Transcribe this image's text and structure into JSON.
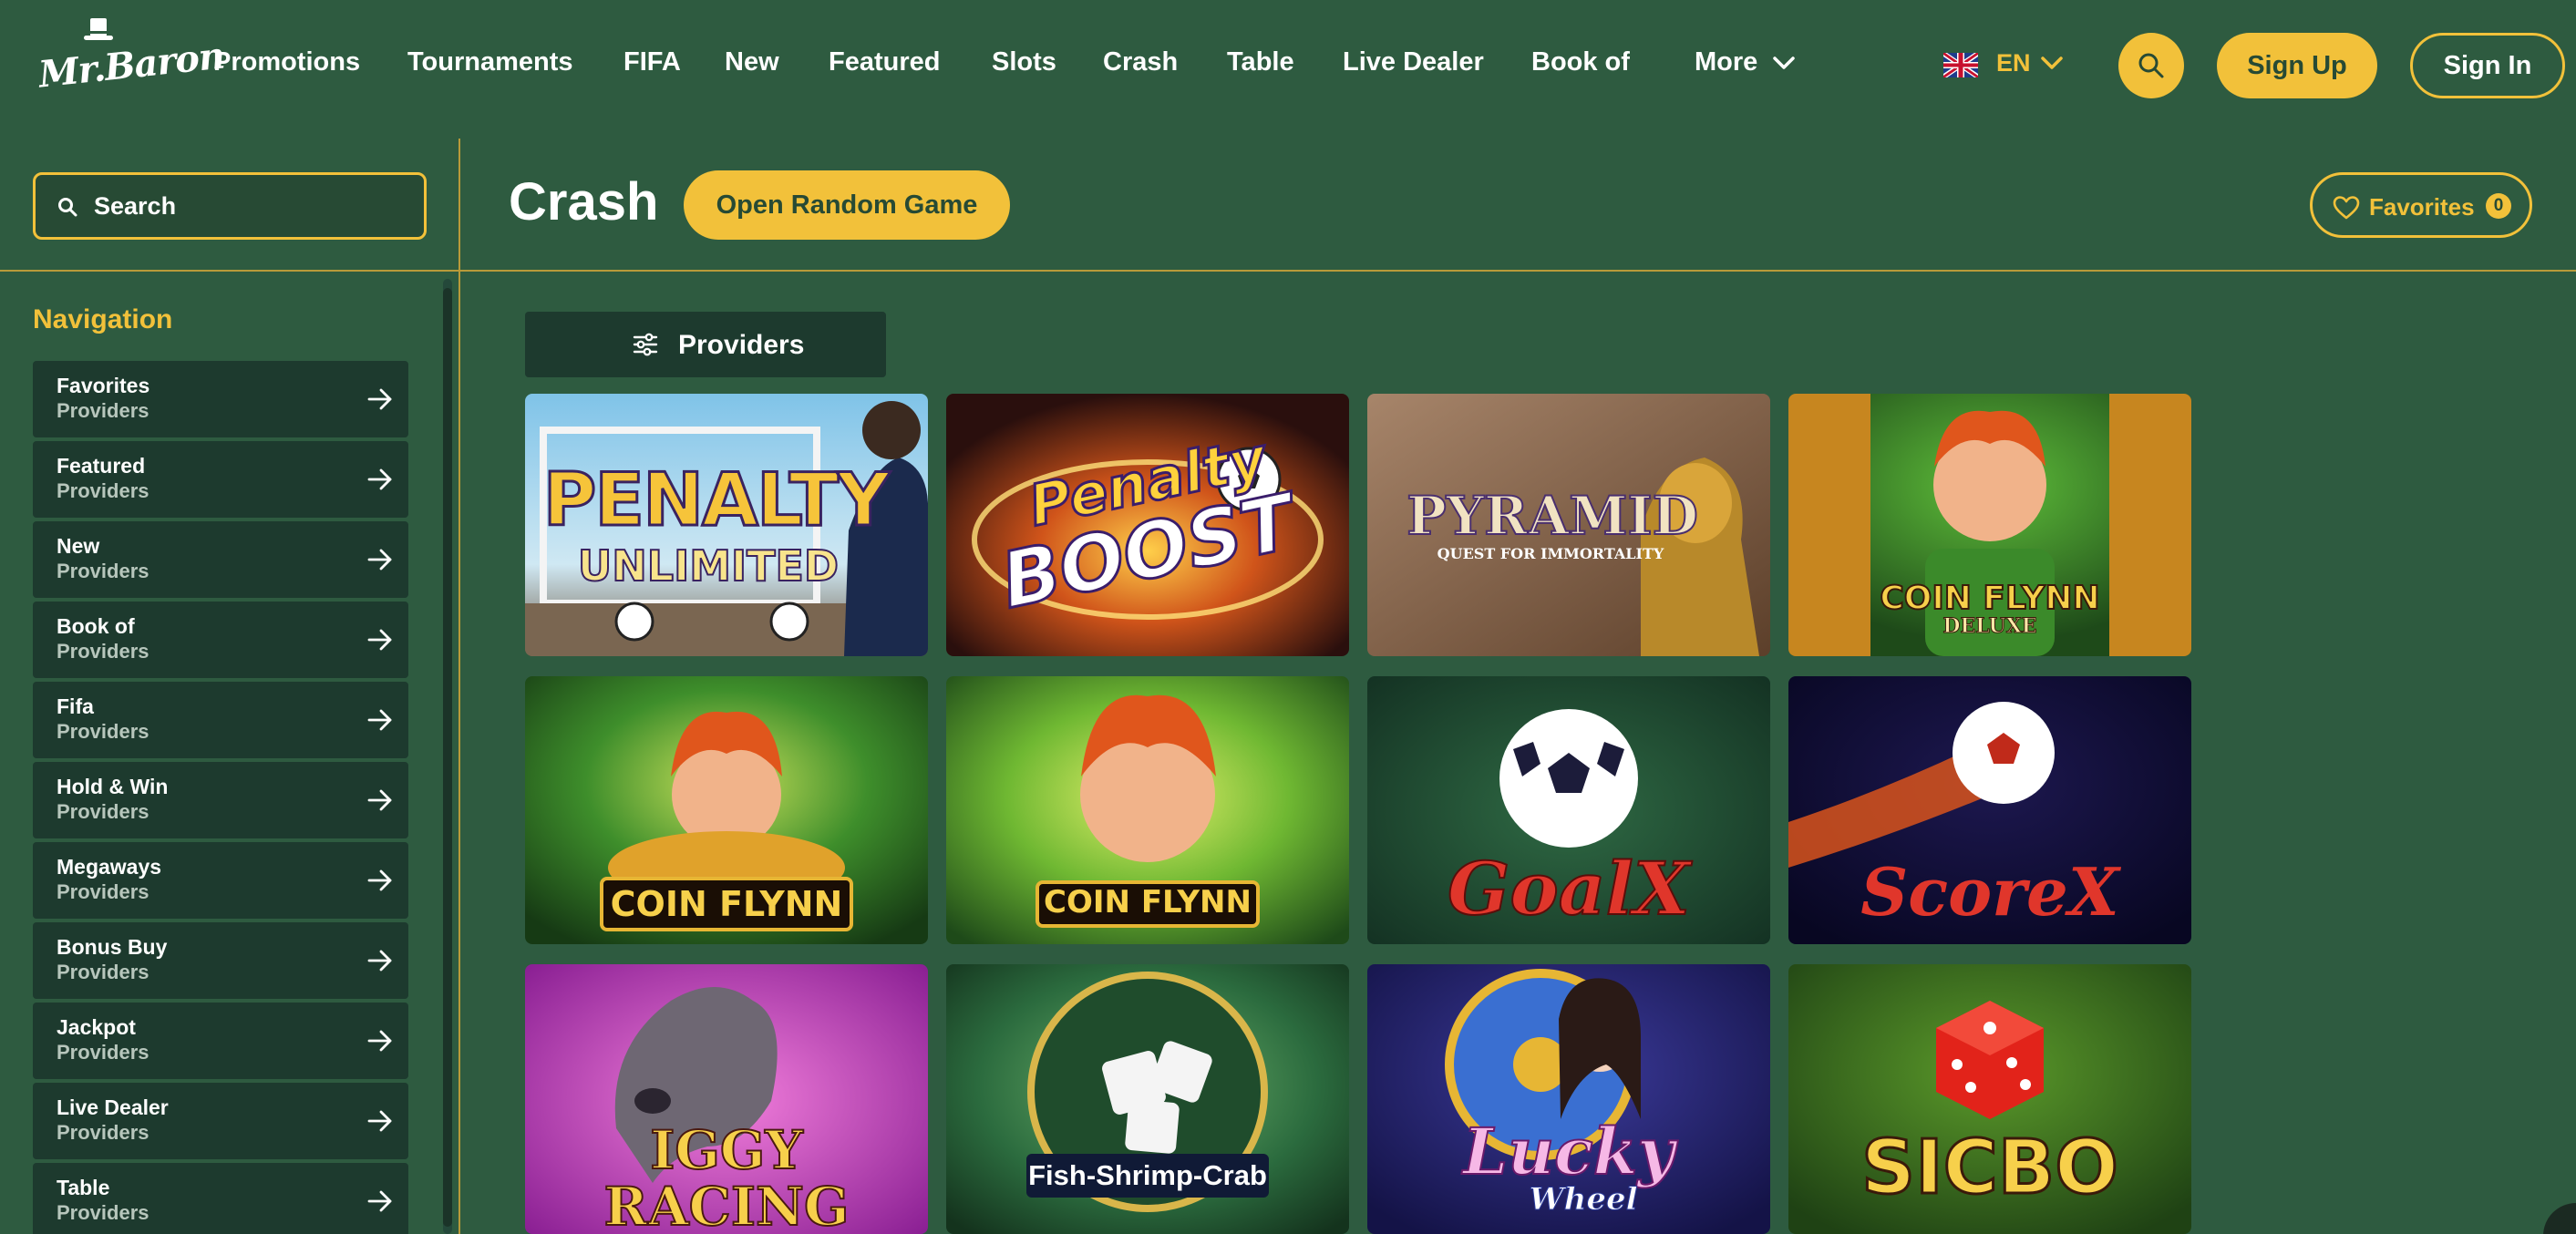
{
  "colors": {
    "background": "#2e5b40",
    "accent": "#f2c13a",
    "sidebar_item_bg": "#1d3a2e",
    "divider": "#b89a3a"
  },
  "header": {
    "logo_text": "Mr.Baron",
    "logo_icon": "top-hat-icon",
    "nav": [
      "Promotions",
      "Tournaments",
      "FIFA",
      "New",
      "Featured",
      "Slots",
      "Crash",
      "Table",
      "Live Dealer",
      "Book of"
    ],
    "more_label": "More",
    "language": {
      "flag": "uk-flag-icon",
      "code": "EN"
    },
    "search_icon": "search-icon",
    "signup_label": "Sign Up",
    "signin_label": "Sign In"
  },
  "search": {
    "placeholder": "Search"
  },
  "page": {
    "title": "Crash",
    "random_button": "Open Random Game",
    "favorites_label": "Favorites",
    "favorites_count": "0"
  },
  "sidebar": {
    "heading": "Navigation",
    "items": [
      {
        "title": "Favorites",
        "subtitle": "Providers"
      },
      {
        "title": "Featured",
        "subtitle": "Providers"
      },
      {
        "title": "New",
        "subtitle": "Providers"
      },
      {
        "title": "Book of",
        "subtitle": "Providers"
      },
      {
        "title": "Fifa",
        "subtitle": "Providers"
      },
      {
        "title": "Hold & Win",
        "subtitle": "Providers"
      },
      {
        "title": "Megaways",
        "subtitle": "Providers"
      },
      {
        "title": "Bonus Buy",
        "subtitle": "Providers"
      },
      {
        "title": "Jackpot",
        "subtitle": "Providers"
      },
      {
        "title": "Live Dealer",
        "subtitle": "Providers"
      },
      {
        "title": "Table",
        "subtitle": "Providers"
      }
    ]
  },
  "providers_button": "Providers",
  "games": [
    {
      "title": "PENALTY",
      "subtitle": "UNLIMITED"
    },
    {
      "title": "Penalty",
      "subtitle": "BOOST"
    },
    {
      "title": "PYRAMID",
      "subtitle": "QUEST FOR IMMORTALITY"
    },
    {
      "title": "COIN FLYNN",
      "subtitle": "DELUXE"
    },
    {
      "title": "COIN FLYNN",
      "subtitle": ""
    },
    {
      "title": "COIN FLYNN",
      "subtitle": ""
    },
    {
      "title": "GoalX",
      "subtitle": ""
    },
    {
      "title": "ScoreX",
      "subtitle": ""
    },
    {
      "title": "IGGY",
      "subtitle": "RACING"
    },
    {
      "title": "Fish-Shrimp-Crab",
      "subtitle": ""
    },
    {
      "title": "Lucky",
      "subtitle": "Wheel"
    },
    {
      "title": "SICBO",
      "subtitle": ""
    }
  ]
}
